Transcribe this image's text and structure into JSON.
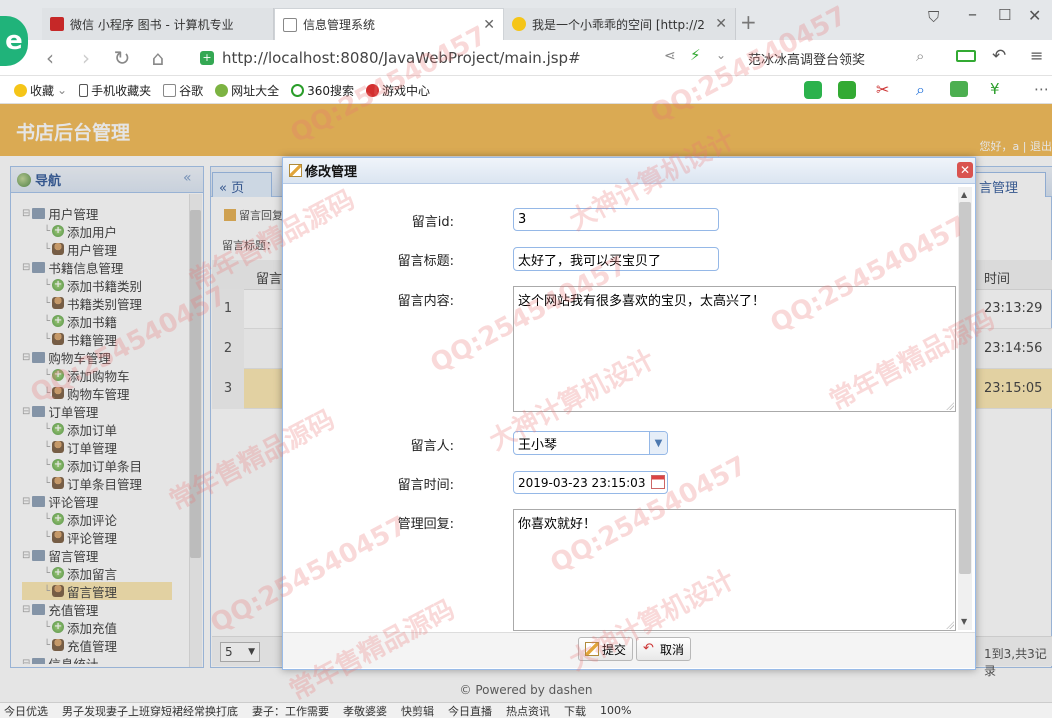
{
  "browser": {
    "tabs": [
      {
        "title": "微信 小程序 图书 - 计算机专业"
      },
      {
        "title": "信息管理系统"
      },
      {
        "title": "我是一个小乖乖的空间 [http://2"
      }
    ],
    "url": "http://localhost:8080/JavaWebProject/main.jsp#",
    "search_text": "范冰冰高调登台领奖",
    "bookmarks": [
      "收藏",
      "手机收藏夹",
      "谷歌",
      "网址大全",
      "360搜索",
      "游戏中心"
    ]
  },
  "app": {
    "title": "书店后台管理",
    "user_info": "您好，a | 退出",
    "footer": "© Powered by dashen"
  },
  "nav": {
    "title": "导航",
    "collapse_glyph": "«",
    "items": [
      {
        "label": "用户管理",
        "type": "folder"
      },
      {
        "label": "添加用户",
        "type": "add"
      },
      {
        "label": "用户管理",
        "type": "user"
      },
      {
        "label": "书籍信息管理",
        "type": "folder"
      },
      {
        "label": "添加书籍类别",
        "type": "add"
      },
      {
        "label": "书籍类别管理",
        "type": "user"
      },
      {
        "label": "添加书籍",
        "type": "add"
      },
      {
        "label": "书籍管理",
        "type": "user"
      },
      {
        "label": "购物车管理",
        "type": "folder"
      },
      {
        "label": "添加购物车",
        "type": "add"
      },
      {
        "label": "购物车管理",
        "type": "user"
      },
      {
        "label": "订单管理",
        "type": "folder"
      },
      {
        "label": "添加订单",
        "type": "add"
      },
      {
        "label": "订单管理",
        "type": "user"
      },
      {
        "label": "添加订单条目",
        "type": "add"
      },
      {
        "label": "订单条目管理",
        "type": "user"
      },
      {
        "label": "评论管理",
        "type": "folder"
      },
      {
        "label": "添加评论",
        "type": "add"
      },
      {
        "label": "评论管理",
        "type": "user"
      },
      {
        "label": "留言管理",
        "type": "folder"
      },
      {
        "label": "添加留言",
        "type": "add"
      },
      {
        "label": "留言管理",
        "type": "user",
        "selected": true
      },
      {
        "label": "充值管理",
        "type": "folder"
      },
      {
        "label": "添加充值",
        "type": "add"
      },
      {
        "label": "充值管理",
        "type": "user"
      },
      {
        "label": "信息统计",
        "type": "folder"
      }
    ]
  },
  "main": {
    "tab_prev": "« 页",
    "tab_right": "言管理",
    "grid_toolbar_label": "留言回复",
    "grid_search_label": "留言标题：",
    "col_header_left": "留言",
    "col_header_time": "时间",
    "rows": [
      {
        "num": "1",
        "time": "23:13:29"
      },
      {
        "num": "2",
        "time": "23:14:56"
      },
      {
        "num": "3",
        "time": "23:15:05"
      }
    ],
    "pager": {
      "page_size": "5",
      "info": "1到3,共3记录"
    }
  },
  "dialog": {
    "title": "修改管理",
    "fields": {
      "id": {
        "label": "留言id:",
        "value": "3"
      },
      "title": {
        "label": "留言标题:",
        "value": "太好了，我可以买宝贝了"
      },
      "content": {
        "label": "留言内容:",
        "value": "这个网站我有很多喜欢的宝贝，太高兴了！"
      },
      "author": {
        "label": "留言人:",
        "value": "王小琴"
      },
      "time": {
        "label": "留言时间:",
        "value": "2019-03-23 23:15:03"
      },
      "reply": {
        "label": "管理回复:",
        "value": "你喜欢就好！"
      }
    },
    "buttons": {
      "submit": "提交",
      "cancel": "取消"
    }
  },
  "statusbar": {
    "items": [
      "今日优选",
      "男子发现妻子上班穿短裙经常换打底",
      "妻子：工作需要",
      "孝敬婆婆",
      "快剪辑",
      "今日直播",
      "热点资讯",
      "下载",
      "100%"
    ]
  },
  "watermarks": [
    "QQ:254540457",
    "大神计算机设计",
    "常年售精品源码"
  ],
  "colors": {
    "header": "#f1b13d",
    "border": "#99bbe8",
    "selection": "#fbe5a6"
  }
}
